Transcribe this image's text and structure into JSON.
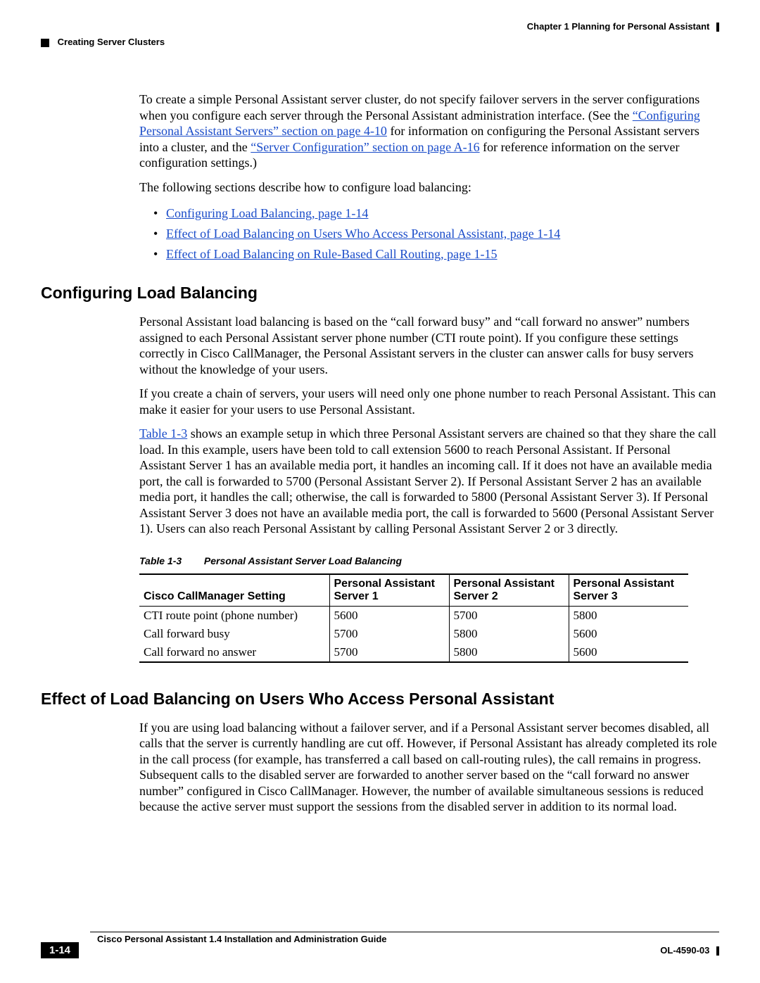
{
  "header": {
    "chapter": "Chapter 1      Planning for Personal Assistant",
    "section": "Creating Server Clusters"
  },
  "intro": {
    "p1a": "To create a simple Personal Assistant server cluster, do not specify failover servers in the server configurations when you configure each server through the Personal Assistant administration interface. (See the ",
    "p1link1": "“Configuring Personal Assistant Servers” section on page 4-10",
    "p1b": " for information on configuring the Personal Assistant servers into a cluster, and the ",
    "p1link2": "“Server Configuration” section on page A-16",
    "p1c": " for reference information on the server configuration settings.)",
    "p2": "The following sections describe how to configure load balancing:",
    "bullets": [
      "Configuring Load Balancing, page 1-14",
      "Effect of Load Balancing on Users Who Access Personal Assistant, page 1-14",
      "Effect of Load Balancing on Rule-Based Call Routing, page 1-15"
    ]
  },
  "sect1": {
    "title": "Configuring Load Balancing",
    "p1": "Personal Assistant load balancing is based on the “call forward busy” and “call forward no answer” numbers assigned to each Personal Assistant server phone number (CTI route point). If you configure these settings correctly in Cisco CallManager, the Personal Assistant servers in the cluster can answer calls for busy servers without the knowledge of your users.",
    "p2": "If you create a chain of servers, your users will need only one phone number to reach Personal Assistant. This can make it easier for your users to use Personal Assistant.",
    "p3link": "Table 1-3",
    "p3": " shows an example setup in which three Personal Assistant servers are chained so that they share the call load. In this example, users have been told to call extension 5600 to reach Personal Assistant. If Personal Assistant Server 1 has an available media port, it handles an incoming call. If it does not have an available media port, the call is forwarded to 5700 (Personal Assistant Server 2). If Personal Assistant Server 2 has an available media port, it handles the call; otherwise, the call is forwarded to 5800 (Personal Assistant Server 3). If Personal Assistant Server 3 does not have an available media port, the call is forwarded to 5600 (Personal Assistant Server 1). Users can also reach Personal Assistant by calling Personal Assistant Server 2 or 3 directly."
  },
  "table": {
    "num": "Table 1-3",
    "title": "Personal Assistant Server Load Balancing",
    "headers": [
      "Cisco CallManager Setting",
      "Personal Assistant Server 1",
      "Personal Assistant Server 2",
      "Personal Assistant Server 3"
    ],
    "rows": [
      [
        "CTI route point (phone number)",
        "5600",
        "5700",
        "5800"
      ],
      [
        "Call forward busy",
        "5700",
        "5800",
        "5600"
      ],
      [
        "Call forward no answer",
        "5700",
        "5800",
        "5600"
      ]
    ]
  },
  "sect2": {
    "title": "Effect of Load Balancing on Users Who Access Personal Assistant",
    "p1": "If you are using load balancing without a failover server, and if a Personal Assistant server becomes disabled, all calls that the server is currently handling are cut off. However, if Personal Assistant has already completed its role in the call process (for example, has transferred a call based on call-routing rules), the call remains in progress. Subsequent calls to the disabled server are forwarded to another server based on the “call forward no answer number” configured in Cisco CallManager. However, the number of available simultaneous sessions is reduced because the active server must support the sessions from the disabled server in addition to its normal load."
  },
  "footer": {
    "guide": "Cisco Personal Assistant 1.4 Installation and Administration Guide",
    "page": "1-14",
    "doc": "OL-4590-03"
  }
}
